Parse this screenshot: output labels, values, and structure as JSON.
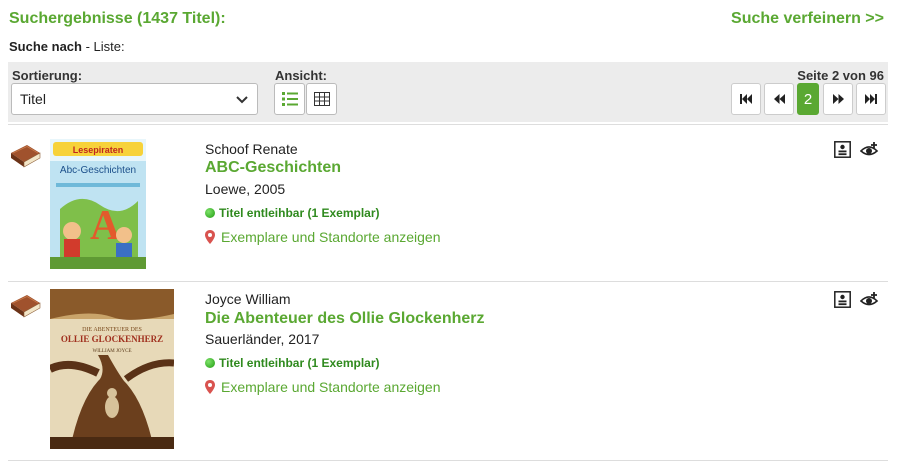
{
  "header": {
    "results_title": "Suchergebnisse (1437 Titel):",
    "refine_link": "Suche verfeinern >>"
  },
  "search": {
    "label": "Suche nach",
    "value": "- Liste:"
  },
  "toolbar": {
    "sort_label": "Sortierung:",
    "sort_value": "Titel",
    "view_label": "Ansicht:",
    "page_info": "Seite 2 von 96",
    "current_page": "2",
    "view_icons": [
      "list-view-icon",
      "grid-view-icon"
    ],
    "pager_icons": [
      "first-page-icon",
      "previous-page-icon",
      "next-page-icon",
      "last-page-icon"
    ]
  },
  "results": [
    {
      "author": "Schoof Renate",
      "title": "ABC-Geschichten",
      "publisher": "Loewe, 2005",
      "availability": "Titel entleihbar (1 Exemplar)",
      "locations_link": "Exemplare und Standorte anzeigen",
      "cover_text": "Abc-Geschichten",
      "cover_banner": "Lesepiraten"
    },
    {
      "author": "Joyce William",
      "title": "Die Abenteuer des Ollie Glockenherz",
      "publisher": "Sauerländer, 2017",
      "availability": "Titel entleihbar (1 Exemplar)",
      "locations_link": "Exemplare und Standorte anzeigen",
      "cover_top": "DIE ABENTEUER DES",
      "cover_title": "OLLIE GLOCKENHERZ",
      "cover_author": "WILLIAM JOYCE"
    }
  ],
  "colors": {
    "accent": "#5aa832",
    "available": "#2f8a1e",
    "location_pin": "#d9534f"
  }
}
